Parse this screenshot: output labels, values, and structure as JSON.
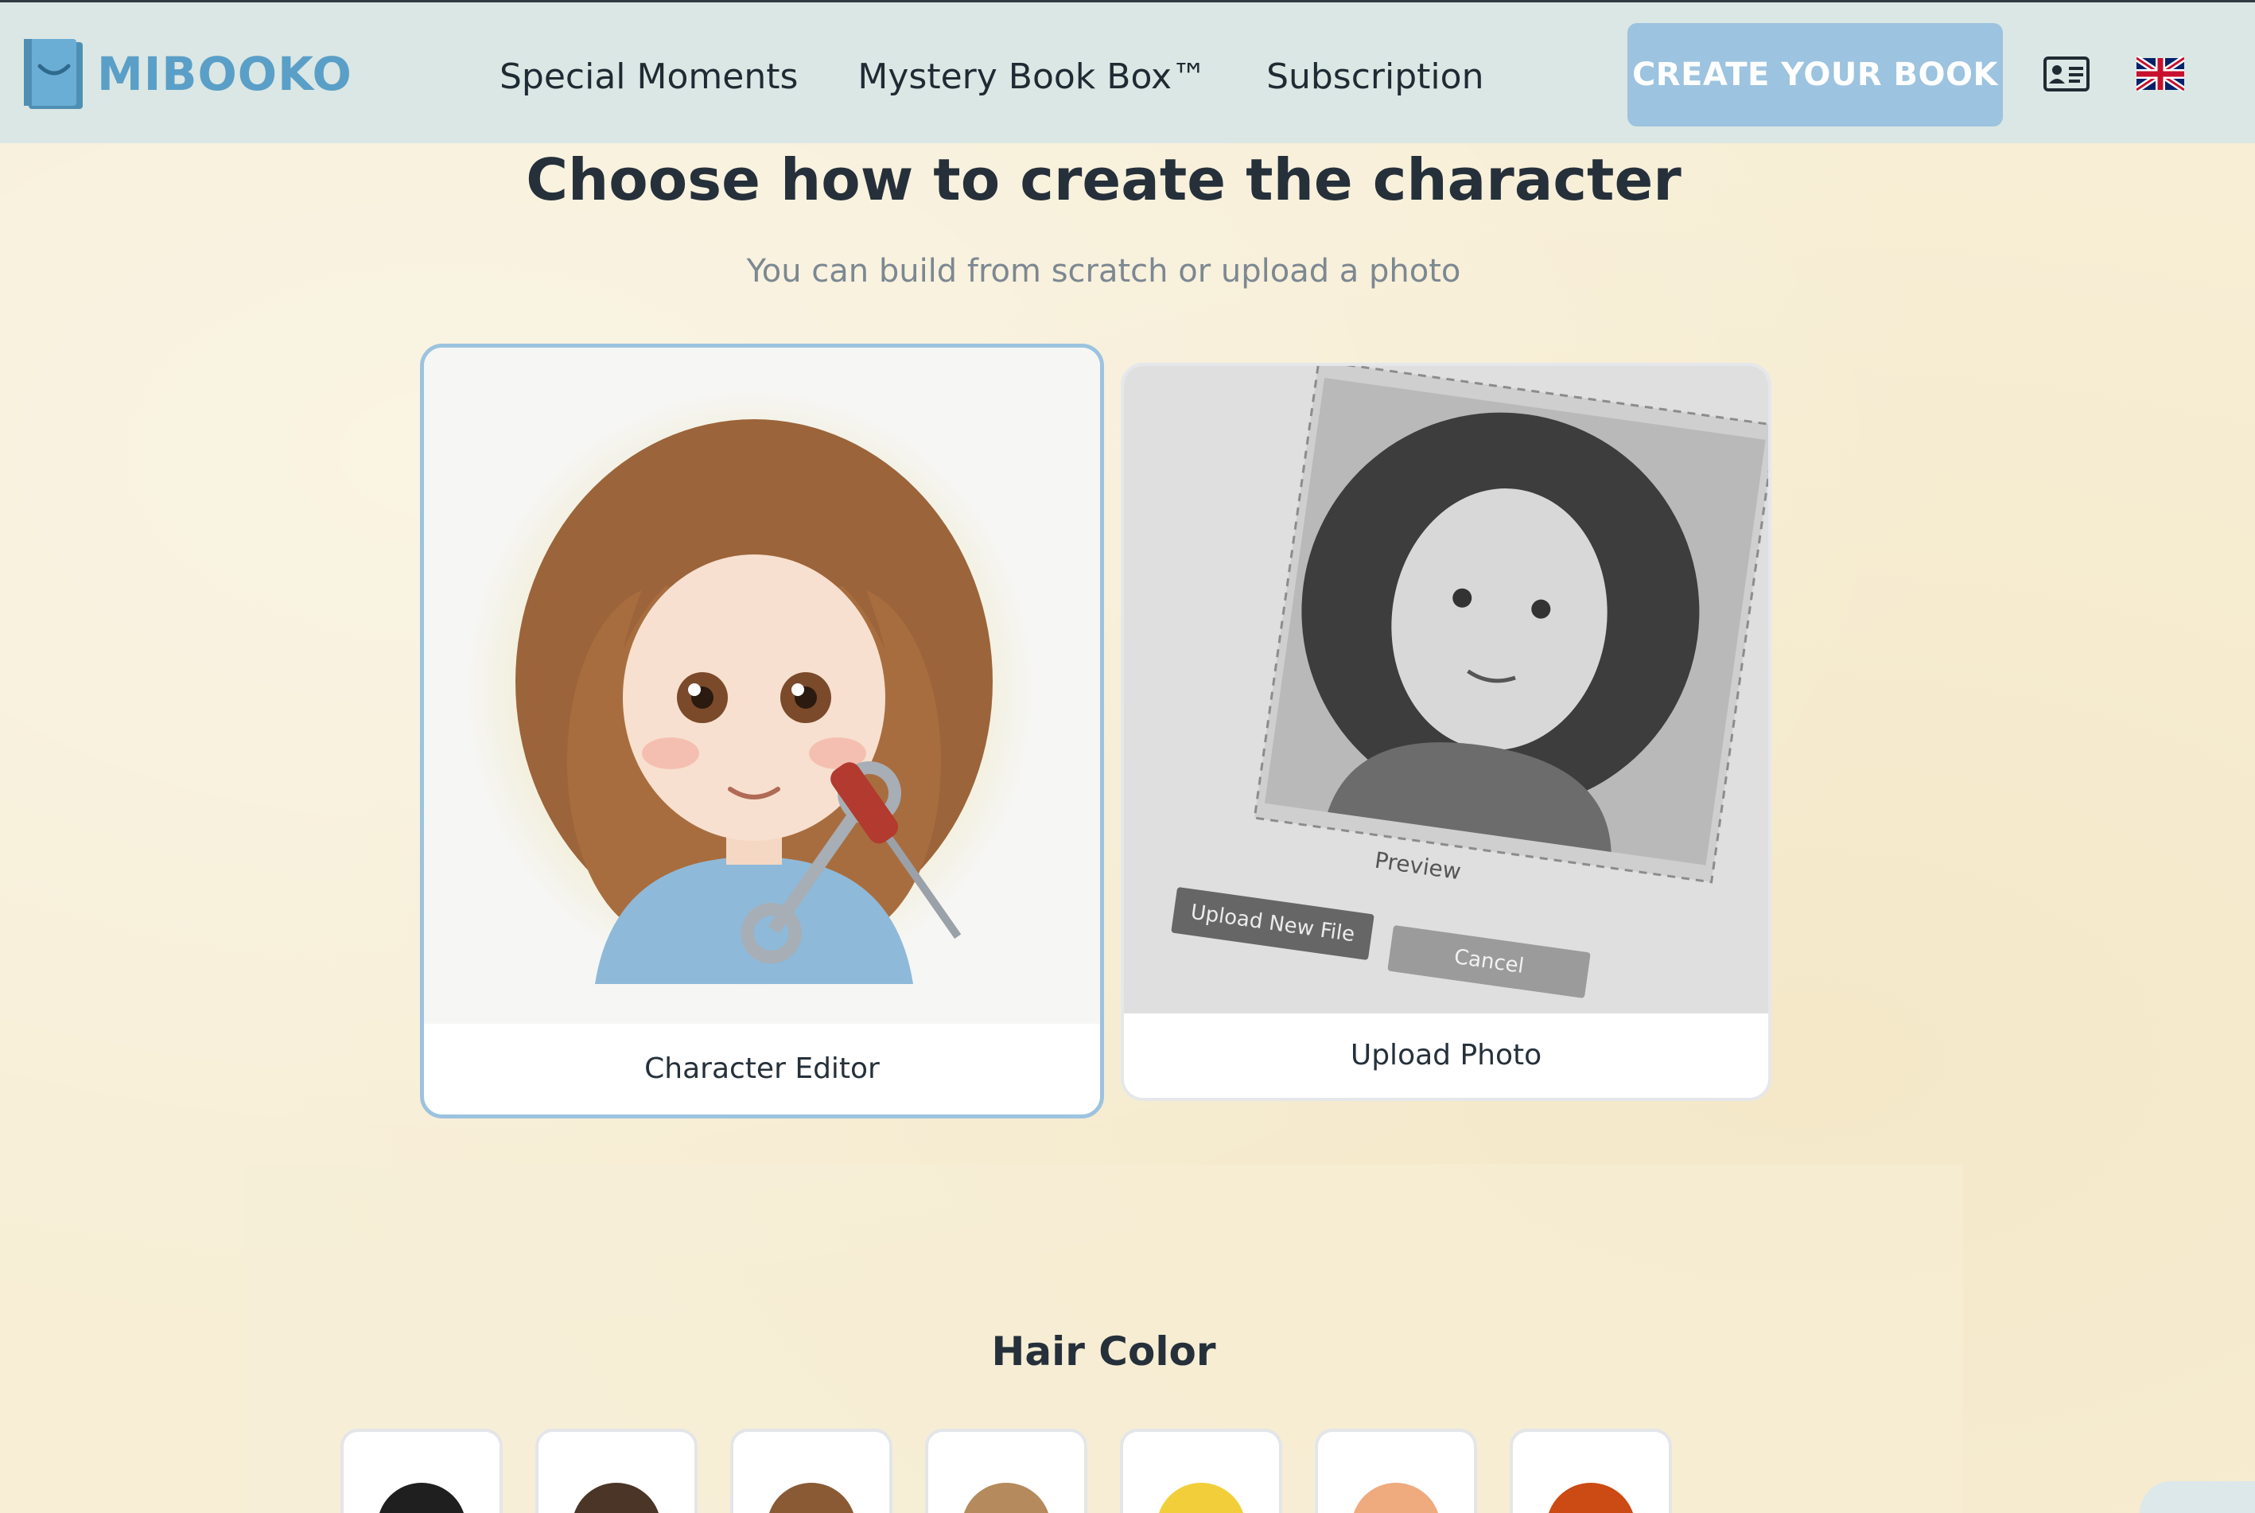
{
  "header": {
    "logo_text": "MIBOOKO",
    "nav": [
      "Special Moments",
      "Mystery Book Box™",
      "Subscription"
    ],
    "cta_label": "CREATE YOUR BOOK",
    "account_icon": "id-card-icon",
    "language_icon": "uk-flag-icon"
  },
  "main": {
    "title": "Choose how to create the character",
    "subtitle": "You can build from scratch or upload a photo",
    "options": [
      {
        "label": "Character Editor",
        "selected": true
      },
      {
        "label": "Upload Photo",
        "selected": false,
        "illustration": {
          "preview_text": "Preview",
          "upload_button": "Upload New File",
          "cancel_button": "Cancel"
        }
      }
    ]
  },
  "hair": {
    "title": "Hair Color",
    "swatches": [
      "#1f1f1f",
      "#4a3526",
      "#8a5a35",
      "#b58a5c",
      "#f2cf3a",
      "#efaa7e",
      "#cc4a14"
    ]
  },
  "colors": {
    "header_bg": "#dbe7e4",
    "accent": "#9cc3df",
    "logo": "#5a9fc7",
    "background": "#f7eed5"
  }
}
